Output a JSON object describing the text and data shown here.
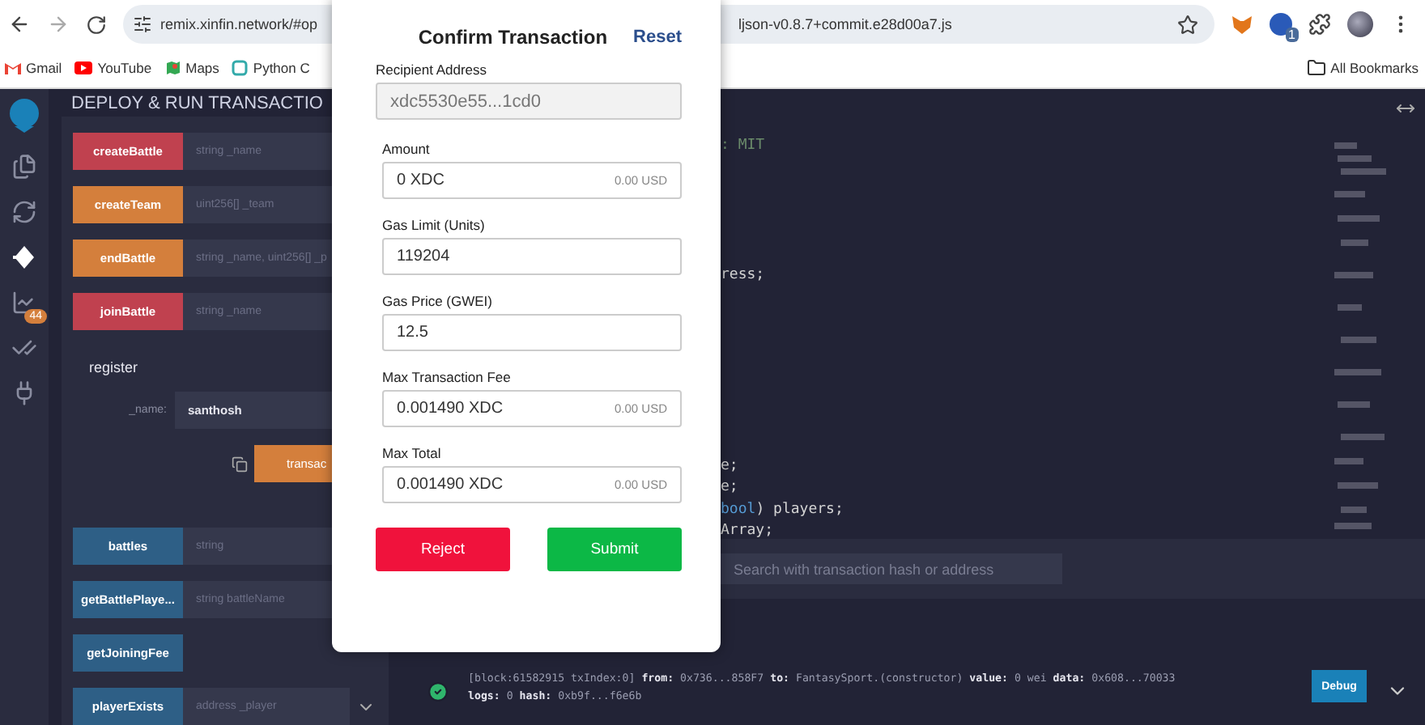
{
  "browser": {
    "url_start": "remix.xinfin.network/#op",
    "url_end": "ljson-v0.8.7+commit.e28d00a7.js",
    "extension_badge": "1",
    "bookmarks": [
      {
        "label": "Gmail",
        "kind": "gmail"
      },
      {
        "label": "YouTube",
        "kind": "youtube"
      },
      {
        "label": "Maps",
        "kind": "maps"
      },
      {
        "label": "Python C",
        "kind": "python"
      }
    ],
    "all_bookmarks": "All Bookmarks"
  },
  "icon_bar": {
    "items": [
      {
        "kind": "files",
        "selected": false
      },
      {
        "kind": "compiler",
        "selected": false
      },
      {
        "kind": "deploy",
        "selected": true
      },
      {
        "kind": "analysis",
        "selected": false,
        "badge": "44"
      },
      {
        "kind": "tests",
        "selected": false
      },
      {
        "kind": "plugins",
        "selected": false
      }
    ]
  },
  "side_panel": {
    "title": "DEPLOY & RUN TRANSACTIO",
    "functions_top": [
      {
        "name": "createBattle",
        "color": "#c0414f",
        "placeholder": "string _name"
      },
      {
        "name": "createTeam",
        "color": "#d47f3c",
        "placeholder": "uint256[] _team"
      },
      {
        "name": "endBattle",
        "color": "#d47f3c",
        "placeholder": "string _name, uint256[] _p"
      },
      {
        "name": "joinBattle",
        "color": "#c0414f",
        "placeholder": "string _name"
      }
    ],
    "register": {
      "name": "register",
      "param_label": "_name:",
      "param_value": "santhosh",
      "button": "transac"
    },
    "functions_bottom": [
      {
        "name": "battles",
        "color": "#2e5f86",
        "placeholder": "string"
      },
      {
        "name": "getBattlePlaye...",
        "color": "#2e5f86",
        "placeholder": "string battleName"
      },
      {
        "name": "getJoiningFee",
        "color": "#2e5f86"
      },
      {
        "name": "playerExists",
        "color": "#2e5f86",
        "placeholder": "address _player",
        "expandable": true
      }
    ]
  },
  "editor": {
    "lines": [
      {
        "segments": [
          {
            "text": ": MIT",
            "kind": "comment"
          }
        ]
      },
      {
        "segments": [
          {
            "text": "ress;",
            "kind": "plain"
          }
        ]
      },
      {
        "segments": [
          {
            "text": "e;",
            "kind": "plain"
          }
        ]
      },
      {
        "segments": [
          {
            "text": "e;",
            "kind": "plain"
          }
        ]
      },
      {
        "segments": [
          {
            "text": "bool",
            "kind": "keyword"
          },
          {
            "text": ") players;",
            "kind": "plain"
          }
        ]
      },
      {
        "segments": [
          {
            "text": "Array;",
            "kind": "plain"
          }
        ]
      }
    ]
  },
  "terminal": {
    "search_placeholder": "Search with transaction hash or address",
    "log": {
      "line_1": "[block:61582915 txIndex:0] **from:** 0x736...858F7 **to:** FantasySport.(constructor) **value:** 0 wei **data:** 0x608...70033",
      "line_2": "**logs:** 0 **hash:** 0xb9f...f6e6b",
      "button": "Debug"
    }
  },
  "modal": {
    "title": "Confirm Transaction",
    "reset": "Reset",
    "fields": [
      {
        "label": "Recipient Address",
        "value": "xdc5530e55...1cd0",
        "disabled": true
      },
      {
        "label": "Amount",
        "value": "0 XDC",
        "usd": "0.00 USD",
        "disabled": false
      },
      {
        "label": "Gas Limit (Units)",
        "value": "119204",
        "disabled": false
      },
      {
        "label": "Gas Price (GWEI)",
        "value": "12.5",
        "disabled": false
      },
      {
        "label": "Max Transaction Fee",
        "value": "0.001490 XDC",
        "usd": "0.00 USD",
        "disabled": false
      },
      {
        "label": "Max Total",
        "value": "0.001490 XDC",
        "usd": "0.00 USD",
        "disabled": false
      }
    ],
    "buttons": [
      {
        "label": "Reject",
        "kind": "reject"
      },
      {
        "label": "Submit",
        "kind": "submit"
      }
    ]
  }
}
